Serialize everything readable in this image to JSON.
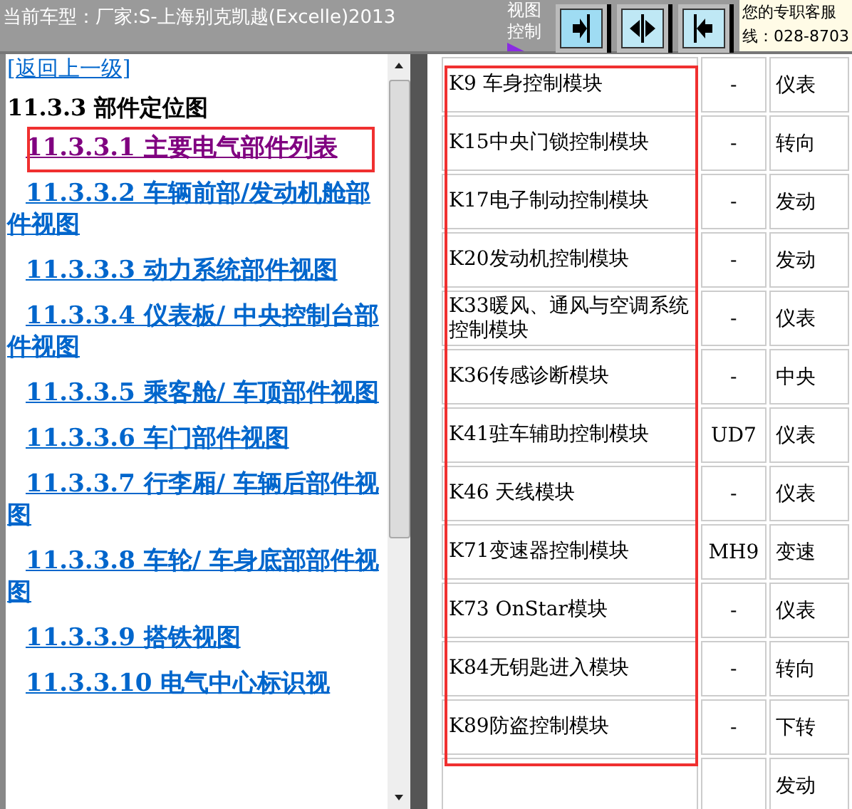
{
  "top_bar": {
    "model_label": "当前车型：厂家:S-上海别克凯越(Excelle)2013",
    "view_control_label": [
      "视图",
      "控制"
    ],
    "view_buttons": [
      {
        "kind": "right",
        "selected": true
      },
      {
        "kind": "both",
        "selected": false
      },
      {
        "kind": "left",
        "selected": false
      }
    ],
    "service_text": [
      "您的专职客服",
      "线：028-8703"
    ]
  },
  "nav": {
    "back_link": "[返回上一级]",
    "heading": "11.3.3 部件定位图",
    "links": [
      {
        "label": "11.3.3.1 主要电气部件列表",
        "visited": true,
        "highlighted": true
      },
      {
        "label": "11.3.3.2 车辆前部/发动机舱部件视图",
        "visited": false,
        "highlighted": false
      },
      {
        "label": "11.3.3.3 动力系统部件视图",
        "visited": false,
        "highlighted": false
      },
      {
        "label": "11.3.3.4 仪表板/ 中央控制台部件视图",
        "visited": false,
        "highlighted": false
      },
      {
        "label": "11.3.3.5 乘客舱/ 车顶部件视图",
        "visited": false,
        "highlighted": false
      },
      {
        "label": "11.3.3.6 车门部件视图",
        "visited": false,
        "highlighted": false
      },
      {
        "label": "11.3.3.7 行李厢/ 车辆后部件视图",
        "visited": false,
        "highlighted": false
      },
      {
        "label": "11.3.3.8 车轮/ 车身底部部件视图",
        "visited": false,
        "highlighted": false
      },
      {
        "label": "11.3.3.9 搭铁视图",
        "visited": false,
        "highlighted": false
      },
      {
        "label": "11.3.3.10 电气中心标识视",
        "visited": false,
        "highlighted": false
      }
    ]
  },
  "table": {
    "first_column_highlighted": true,
    "rows": [
      {
        "name": "K9 车身控制模块",
        "code": "-",
        "column_3": "仪表"
      },
      {
        "name": "K15中央门锁控制模块",
        "code": "-",
        "column_3": "转向"
      },
      {
        "name": "K17电子制动控制模块",
        "code": "-",
        "column_3": "发动"
      },
      {
        "name": "K20发动机控制模块",
        "code": "-",
        "column_3": "发动"
      },
      {
        "name": "K33暖风、通风与空调系统控制模块",
        "code": "-",
        "column_3": "仪表"
      },
      {
        "name": "K36传感诊断模块",
        "code": "-",
        "column_3": "中央"
      },
      {
        "name": "K41驻车辅助控制模块",
        "code": "UD7",
        "column_3": "仪表"
      },
      {
        "name": "K46 天线模块",
        "code": "-",
        "column_3": "仪表"
      },
      {
        "name": "K71变速器控制模块",
        "code": "MH9",
        "column_3": "变速"
      },
      {
        "name": "K73 OnStar模块",
        "code": "-",
        "column_3": "仪表"
      },
      {
        "name": "K84无钥匙进入模块",
        "code": "-",
        "column_3": "转向"
      },
      {
        "name": "K89防盗控制模块",
        "code": "-",
        "column_3": "下转"
      },
      {
        "column_3": "发动"
      }
    ]
  }
}
